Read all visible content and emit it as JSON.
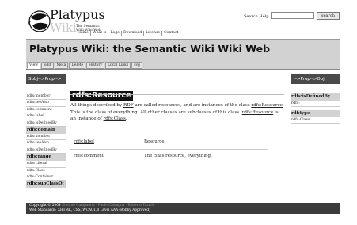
{
  "site": {
    "name": "Platypus",
    "name2": "Wiki",
    "tagline1": "The Semantic",
    "tagline2": "Wiki Wiki Web"
  },
  "topnav": [
    "Home",
    "What is",
    "Logo",
    "Download",
    "License",
    "Contact"
  ],
  "search": {
    "label": "Search Help",
    "value": "",
    "button": "search"
  },
  "page": {
    "title": "Platypus Wiki: the Semantic Wiki Wiki Web"
  },
  "tabs": [
    {
      "label": "View",
      "active": true
    },
    {
      "label": "Edit"
    },
    {
      "label": "Meta"
    },
    {
      "label": "Delete"
    },
    {
      "label": "History"
    },
    {
      "label": "Local Links"
    },
    {
      "label": "svg"
    }
  ],
  "left": {
    "header": "Subj-->Prop-->",
    "groups": [
      {
        "items": [
          "rdfs:member",
          "rdfs:seeAlso",
          "rdfs:comment",
          "rdfs:label",
          "rdfs:isDefinedBy"
        ],
        "section": "rdfs:domain"
      },
      {
        "items": [
          "rdfs:member",
          "rdfs:seeAlso",
          "rdfs:isDefinedBy"
        ],
        "section": "rdfs:range"
      },
      {
        "items": [
          "rdfs:Literal",
          "rdfs:Class",
          "rdfs:Container"
        ],
        "section": "rdfs:subClassOf"
      }
    ]
  },
  "main": {
    "resource": "rdfs:Resource",
    "desc_a": "All things described by ",
    "desc_rdf": "RDF",
    "desc_b": " are called resources, and are instances of the class ",
    "desc_res1": "rdfs:Resource",
    "desc_c": ". This is the class of everything. All other classes are subclasses of this class. ",
    "desc_res2": "rdfs:Resource",
    "desc_d": " is an instance of ",
    "desc_cls": "rdfs:Class",
    "desc_e": ".",
    "props": [
      {
        "key": "rdfs:label",
        "value": "Resource"
      },
      {
        "key": "rdfs:comment",
        "value": "The class resource, everything."
      }
    ]
  },
  "right": {
    "header": "-->Prop-->Obj",
    "sections": [
      {
        "title": "rdfs:isDefinedBy",
        "items": [
          "rdfs:"
        ]
      },
      {
        "title": "rdf:type",
        "items": [
          "rdfs:Class"
        ]
      }
    ]
  },
  "footer": {
    "copyright": "Copyright © 2004",
    "credits": "Stefano Campanini · Paolo Castagna · Roberto Tazzoli",
    "standards": "Web Standards: XHTML, CSS, WCAG1.0 Level AAA (Bobby Approved)"
  }
}
